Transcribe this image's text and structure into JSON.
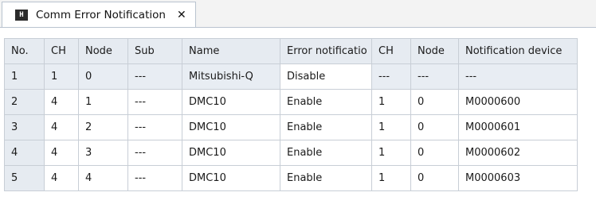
{
  "tab": {
    "icon": "grid-app-icon",
    "title": "Comm Error Notification",
    "close_symbol": "✕"
  },
  "table": {
    "columns": [
      "No.",
      "CH",
      "Node",
      "Sub",
      "Name",
      "Error notificatio",
      "CH",
      "Node",
      "Notification device"
    ],
    "rows": [
      [
        "1",
        "1",
        "0",
        "---",
        "Mitsubishi-Q",
        "Disable",
        "---",
        "---",
        "---"
      ],
      [
        "2",
        "4",
        "1",
        "---",
        "DMC10",
        "Enable",
        "1",
        "0",
        "M0000600"
      ],
      [
        "3",
        "4",
        "2",
        "---",
        "DMC10",
        "Enable",
        "1",
        "0",
        "M0000601"
      ],
      [
        "4",
        "4",
        "3",
        "---",
        "DMC10",
        "Enable",
        "1",
        "0",
        "M0000602"
      ],
      [
        "5",
        "4",
        "4",
        "---",
        "DMC10",
        "Enable",
        "1",
        "0",
        "M0000603"
      ]
    ]
  }
}
